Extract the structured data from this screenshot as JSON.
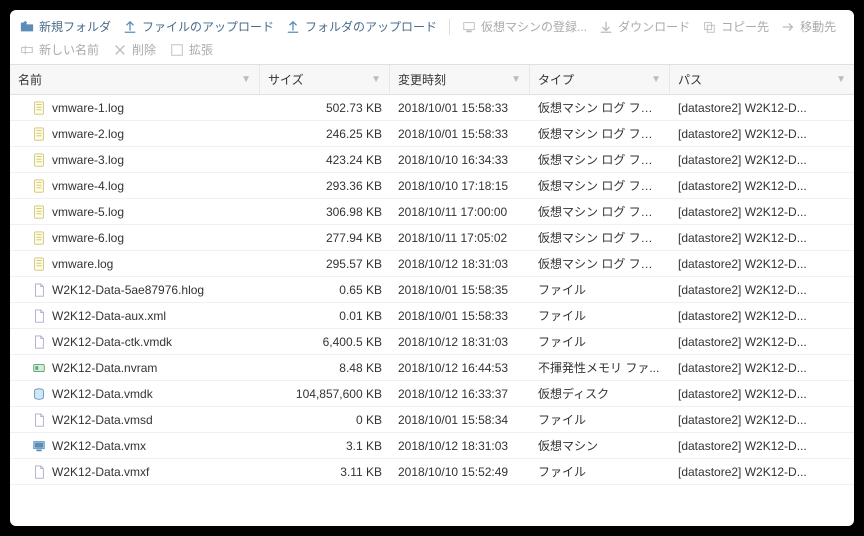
{
  "toolbar": {
    "new_folder": "新規フォルダ",
    "upload_file": "ファイルのアップロード",
    "upload_folder": "フォルダのアップロード",
    "register_vm": "仮想マシンの登録...",
    "download": "ダウンロード",
    "copy_to": "コピー先",
    "move_to": "移動先",
    "new_name": "新しい名前",
    "delete": "削除",
    "expand": "拡張"
  },
  "columns": {
    "name": "名前",
    "size": "サイズ",
    "modified": "変更時刻",
    "type": "タイプ",
    "path": "パス"
  },
  "files": [
    {
      "icon": "log",
      "name": "vmware-1.log",
      "size": "502.73 KB",
      "date": "2018/10/01 15:58:33",
      "type": "仮想マシン ログ ファ...",
      "path": "[datastore2] W2K12-D..."
    },
    {
      "icon": "log",
      "name": "vmware-2.log",
      "size": "246.25 KB",
      "date": "2018/10/01 15:58:33",
      "type": "仮想マシン ログ ファ...",
      "path": "[datastore2] W2K12-D..."
    },
    {
      "icon": "log",
      "name": "vmware-3.log",
      "size": "423.24 KB",
      "date": "2018/10/10 16:34:33",
      "type": "仮想マシン ログ ファ...",
      "path": "[datastore2] W2K12-D..."
    },
    {
      "icon": "log",
      "name": "vmware-4.log",
      "size": "293.36 KB",
      "date": "2018/10/10 17:18:15",
      "type": "仮想マシン ログ ファ...",
      "path": "[datastore2] W2K12-D..."
    },
    {
      "icon": "log",
      "name": "vmware-5.log",
      "size": "306.98 KB",
      "date": "2018/10/11 17:00:00",
      "type": "仮想マシン ログ ファ...",
      "path": "[datastore2] W2K12-D..."
    },
    {
      "icon": "log",
      "name": "vmware-6.log",
      "size": "277.94 KB",
      "date": "2018/10/11 17:05:02",
      "type": "仮想マシン ログ ファ...",
      "path": "[datastore2] W2K12-D..."
    },
    {
      "icon": "log",
      "name": "vmware.log",
      "size": "295.57 KB",
      "date": "2018/10/12 18:31:03",
      "type": "仮想マシン ログ ファ...",
      "path": "[datastore2] W2K12-D..."
    },
    {
      "icon": "file",
      "name": "W2K12-Data-5ae87976.hlog",
      "size": "0.65 KB",
      "date": "2018/10/01 15:58:35",
      "type": "ファイル",
      "path": "[datastore2] W2K12-D..."
    },
    {
      "icon": "file",
      "name": "W2K12-Data-aux.xml",
      "size": "0.01 KB",
      "date": "2018/10/01 15:58:33",
      "type": "ファイル",
      "path": "[datastore2] W2K12-D..."
    },
    {
      "icon": "file",
      "name": "W2K12-Data-ctk.vmdk",
      "size": "6,400.5 KB",
      "date": "2018/10/12 18:31:03",
      "type": "ファイル",
      "path": "[datastore2] W2K12-D..."
    },
    {
      "icon": "nvram",
      "name": "W2K12-Data.nvram",
      "size": "8.48 KB",
      "date": "2018/10/12 16:44:53",
      "type": "不揮発性メモリ ファ...",
      "path": "[datastore2] W2K12-D..."
    },
    {
      "icon": "vmdk",
      "name": "W2K12-Data.vmdk",
      "size": "104,857,600 KB",
      "date": "2018/10/12 16:33:37",
      "type": "仮想ディスク",
      "path": "[datastore2] W2K12-D..."
    },
    {
      "icon": "file",
      "name": "W2K12-Data.vmsd",
      "size": "0 KB",
      "date": "2018/10/01 15:58:34",
      "type": "ファイル",
      "path": "[datastore2] W2K12-D..."
    },
    {
      "icon": "vmx",
      "name": "W2K12-Data.vmx",
      "size": "3.1 KB",
      "date": "2018/10/12 18:31:03",
      "type": "仮想マシン",
      "path": "[datastore2] W2K12-D..."
    },
    {
      "icon": "file",
      "name": "W2K12-Data.vmxf",
      "size": "3.11 KB",
      "date": "2018/10/10 15:52:49",
      "type": "ファイル",
      "path": "[datastore2] W2K12-D..."
    }
  ]
}
